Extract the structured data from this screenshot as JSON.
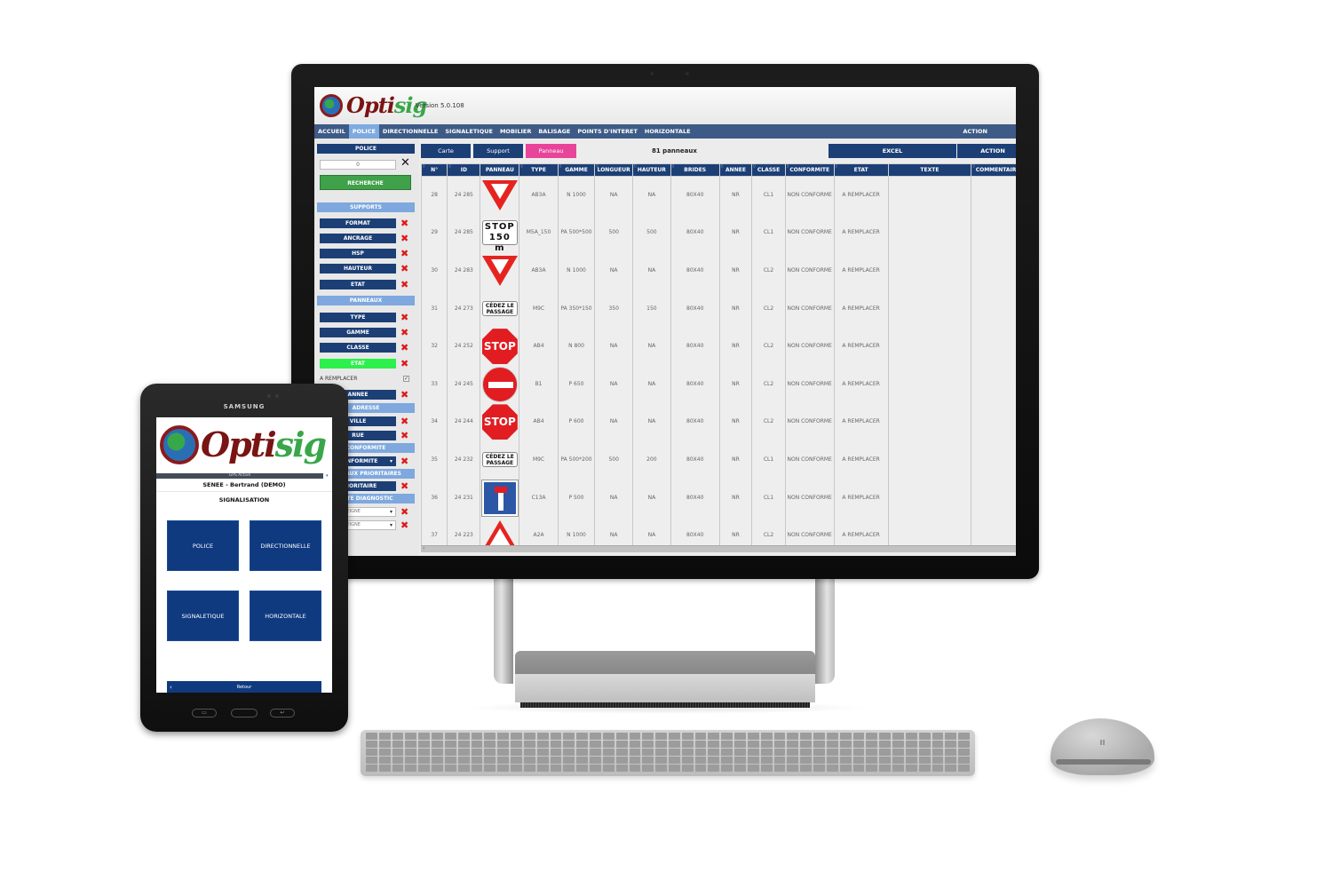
{
  "desktop_app": {
    "logo": {
      "opti": "Opti",
      "sig": "sig"
    },
    "version": "Version 5.0.108",
    "nav": {
      "items": [
        "ACCUEIL",
        "POLICE",
        "DIRECTIONNELLE",
        "SIGNALETIQUE",
        "MOBILIER",
        "BALISAGE",
        "POINTS D'INTERET",
        "HORIZONTALE"
      ],
      "active": "POLICE",
      "action": "ACTION"
    },
    "sidebar": {
      "title": "POLICE",
      "search_value": "0",
      "search_button": "RECHERCHE",
      "sections": {
        "supports": "SUPPORTS",
        "panneaux": "PANNEAUX",
        "adresse": "ADRESSE",
        "conformite": "CONFORMITE",
        "travaux_prioritaires": "TRAVAUX PRIORITAIRES",
        "diagnostic": "DATE DIAGNOSTIC"
      },
      "support_filters": [
        "FORMAT",
        "ANCRAGE",
        "HSP",
        "HAUTEUR",
        "ETAT"
      ],
      "panneau_filters": [
        "TYPE",
        "GAMME",
        "CLASSE",
        "ETAT"
      ],
      "etat_option": {
        "label": "A REMPLACER",
        "checked": true
      },
      "annee_filter": "ANNEE",
      "adresse_filters": [
        "VILLE",
        "RUE"
      ],
      "conformite_select": "CONFORMITE",
      "prioritaire_filter": "PRIORITAIRE",
      "diagnostic_selects": [
        "NON RENSEIGNE",
        "NON RENSEIGNE"
      ]
    },
    "toolbar": {
      "tabs": [
        "Carte",
        "Support",
        "Panneau"
      ],
      "active_tab": "Panneau",
      "count": "81 panneaux",
      "excel": "EXCEL",
      "action_button": "ACTION"
    },
    "table": {
      "columns": [
        "N°",
        "ID",
        "PANNEAU",
        "TYPE",
        "GAMME",
        "LONGUEUR",
        "HAUTEUR",
        "BRIDES",
        "ANNEE",
        "CLASSE",
        "CONFORMITE",
        "ETAT",
        "TEXTE",
        "COMMENTAIRE"
      ],
      "rows": [
        {
          "no": "28",
          "id": "24 285",
          "sign": "yield",
          "type": "AB3A",
          "gamme": "N 1000",
          "longueur": "NA",
          "hauteur": "NA",
          "brides": "80X40",
          "annee": "NR",
          "classe": "CL1",
          "conformite": "NON CONFORME",
          "etat": "A REMPLACER",
          "texte": ""
        },
        {
          "no": "29",
          "id": "24 285",
          "sign": "stop150",
          "sign_text": "STOP 150 m",
          "type": "M5A_150",
          "gamme": "PA 500*500",
          "longueur": "500",
          "hauteur": "500",
          "brides": "80X40",
          "annee": "NR",
          "classe": "CL1",
          "conformite": "NON CONFORME",
          "etat": "A REMPLACER",
          "texte": ""
        },
        {
          "no": "30",
          "id": "24 283",
          "sign": "yield",
          "type": "AB3A",
          "gamme": "N 1000",
          "longueur": "NA",
          "hauteur": "NA",
          "brides": "80X40",
          "annee": "NR",
          "classe": "CL2",
          "conformite": "NON CONFORME",
          "etat": "A REMPLACER",
          "texte": ""
        },
        {
          "no": "31",
          "id": "24 273",
          "sign": "cedez",
          "sign_text": "CÉDEZ LE PASSAGE",
          "type": "M9C",
          "gamme": "PA 350*150",
          "longueur": "350",
          "hauteur": "150",
          "brides": "80X40",
          "annee": "NR",
          "classe": "CL2",
          "conformite": "NON CONFORME",
          "etat": "A REMPLACER",
          "texte": ""
        },
        {
          "no": "32",
          "id": "24 252",
          "sign": "stop",
          "sign_text": "STOP",
          "type": "AB4",
          "gamme": "N 800",
          "longueur": "NA",
          "hauteur": "NA",
          "brides": "80X40",
          "annee": "NR",
          "classe": "CL2",
          "conformite": "NON CONFORME",
          "etat": "A REMPLACER",
          "texte": ""
        },
        {
          "no": "33",
          "id": "24 245",
          "sign": "noentry",
          "type": "B1",
          "gamme": "P 650",
          "longueur": "NA",
          "hauteur": "NA",
          "brides": "80X40",
          "annee": "NR",
          "classe": "CL2",
          "conformite": "NON CONFORME",
          "etat": "A REMPLACER",
          "texte": ""
        },
        {
          "no": "34",
          "id": "24 244",
          "sign": "stop",
          "sign_text": "STOP",
          "type": "AB4",
          "gamme": "P 600",
          "longueur": "NA",
          "hauteur": "NA",
          "brides": "80X40",
          "annee": "NR",
          "classe": "CL2",
          "conformite": "NON CONFORME",
          "etat": "A REMPLACER",
          "texte": ""
        },
        {
          "no": "35",
          "id": "24 232",
          "sign": "cedez",
          "sign_text": "CÉDEZ LE PASSAGE",
          "type": "M9C",
          "gamme": "PA 500*200",
          "longueur": "500",
          "hauteur": "200",
          "brides": "80X40",
          "annee": "NR",
          "classe": "CL1",
          "conformite": "NON CONFORME",
          "etat": "A REMPLACER",
          "texte": ""
        },
        {
          "no": "36",
          "id": "24 231",
          "sign": "deadend",
          "type": "C13A",
          "gamme": "P 500",
          "longueur": "NA",
          "hauteur": "NA",
          "brides": "80X40",
          "annee": "NR",
          "classe": "CL1",
          "conformite": "NON CONFORME",
          "etat": "A REMPLACER",
          "texte": ""
        },
        {
          "no": "37",
          "id": "24 223",
          "sign": "bump",
          "type": "A2A",
          "gamme": "N 1000",
          "longueur": "NA",
          "hauteur": "NA",
          "brides": "80X40",
          "annee": "NR",
          "classe": "CL2",
          "conformite": "NON CONFORME",
          "etat": "A REMPLACER",
          "texte": ""
        }
      ]
    }
  },
  "tablet_app": {
    "brand": "SAMSUNG",
    "logo": {
      "opti": "Opti",
      "sig": "sig"
    },
    "gps_status": "GPS Activé",
    "user": "SENEE - Bertrand (DEMO)",
    "section": "SIGNALISATION",
    "buttons": [
      "POLICE",
      "DIRECTIONNELLE",
      "SIGNALETIQUE",
      "HORIZONTALE"
    ],
    "back": "Retour"
  },
  "colors": {
    "navy": "#1c3f76",
    "nav_bar": "#3d5b86",
    "nav_active": "#7eaae0",
    "panneau_tab": "#e8449a",
    "search_green": "#3fa14a",
    "etat_green": "#2cf04b",
    "remove_red": "#e01818",
    "tablet_button": "#0f3a80"
  }
}
